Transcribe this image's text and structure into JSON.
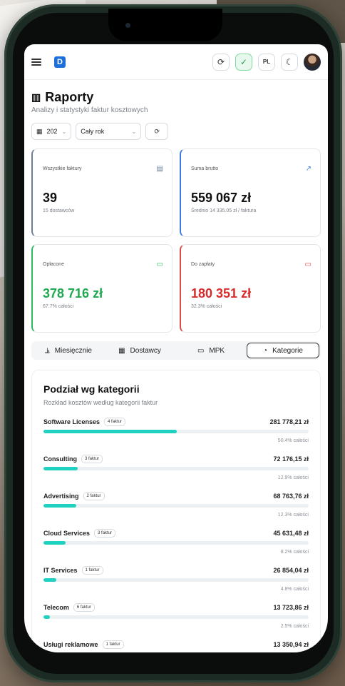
{
  "topbar": {
    "logo_letter": "D",
    "lang_label": "PL"
  },
  "page": {
    "title": "Raporty",
    "subtitle": "Analizy i statystyki faktur kosztowych"
  },
  "filters": {
    "year_value": "202",
    "period_value": "Cały rok"
  },
  "stats": [
    {
      "label": "Wszystkie faktury",
      "value": "39",
      "sub": "15 dostawców"
    },
    {
      "label": "Suma brutto",
      "value": "559 067 zł",
      "sub": "Średnio 14 335.05 zł / faktura"
    },
    {
      "label": "Opłacone",
      "value": "378 716 zł",
      "sub": "67.7% całości"
    },
    {
      "label": "Do zapłaty",
      "value": "180 351 zł",
      "sub": "32.3% całości"
    }
  ],
  "tabs": [
    {
      "label": "Miesięcznie"
    },
    {
      "label": "Dostawcy"
    },
    {
      "label": "MPK"
    },
    {
      "label": "Kategorie"
    }
  ],
  "categories_panel": {
    "title": "Podział wg kategorii",
    "subtitle": "Rozkład kosztów według kategorii faktur",
    "items": [
      {
        "name": "Software Licenses",
        "count": "4 faktur",
        "amount": "281 778,21 zł",
        "pct": "50.4% całości",
        "fraction": 0.504
      },
      {
        "name": "Consulting",
        "count": "3 faktur",
        "amount": "72 176,15 zł",
        "pct": "12.9% całości",
        "fraction": 0.129
      },
      {
        "name": "Advertising",
        "count": "2 faktur",
        "amount": "68 763,76 zł",
        "pct": "12.3% całości",
        "fraction": 0.123
      },
      {
        "name": "Cloud Services",
        "count": "3 faktur",
        "amount": "45 631,48 zł",
        "pct": "8.2% całości",
        "fraction": 0.082
      },
      {
        "name": "IT Services",
        "count": "1 faktur",
        "amount": "26 854,04 zł",
        "pct": "4.8% całości",
        "fraction": 0.048
      },
      {
        "name": "Telecom",
        "count": "6 faktur",
        "amount": "13 723,86 zł",
        "pct": "2.5% całości",
        "fraction": 0.025
      },
      {
        "name": "Usługi reklamowe",
        "count": "1 faktur",
        "amount": "13 350,94 zł",
        "pct": "",
        "fraction": 0.024
      }
    ]
  },
  "colors": {
    "accent": "#1fd1c0",
    "paid": "#1fa84f",
    "due": "#d92b2b",
    "brand": "#1e6fd9"
  }
}
